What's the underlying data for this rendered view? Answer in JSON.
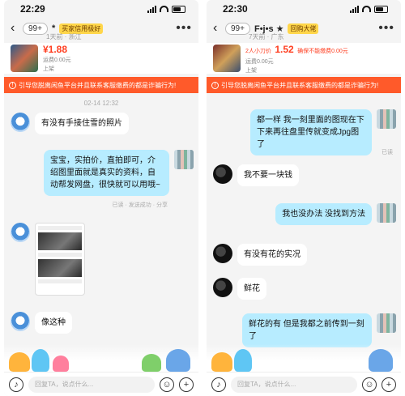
{
  "left": {
    "status": {
      "time": "22:29"
    },
    "nav": {
      "unread_badge": "99+",
      "name": "*",
      "tag": "买家信用极好",
      "sub": "1天前 · 浙江"
    },
    "product": {
      "price": "¥1.88",
      "shipping": "运费0.00元",
      "status": "上架"
    },
    "warning": "引导您脱离闲鱼平台并且联系客服缴费的都是诈骗行为!",
    "chat": {
      "date": "02-14 12:32",
      "messages": [
        {
          "side": "left",
          "text": "有没有手接住雪的照片"
        },
        {
          "side": "right",
          "text": "宝宝，实拍价，直拍即可，介绍图里面就是真实的资料，自动帮发网盘，很快就可以用哦~"
        },
        {
          "side": "left",
          "type": "image"
        },
        {
          "side": "left",
          "text": "像这种"
        }
      ],
      "read_meta": "已读 · 发送成功 · 分享"
    },
    "input_placeholder": "回复TA，说点什么..."
  },
  "right": {
    "status": {
      "time": "22:30"
    },
    "nav": {
      "unread_badge": "99+",
      "name": "F•j•s ★",
      "tag": "回购大佬",
      "sub": "7天前 · 广东"
    },
    "product": {
      "prefix": "2人小刀价",
      "price": "1.52",
      "promo": "确保不能缴费0.00元",
      "shipping": "运费0.00元",
      "status": "上架"
    },
    "warning": "引导您脱离闲鱼平台并且联系客服缴费的都是诈骗行为!",
    "chat": {
      "messages": [
        {
          "side": "right",
          "text": "都一样 我一刻里面的图现在下下来再往盘里传就变成Jpg图了"
        },
        {
          "side": "left",
          "text": "我不要一块钱"
        },
        {
          "side": "right",
          "text": "我也没办法 没找到方法"
        },
        {
          "side": "left",
          "text": "有没有花的实况"
        },
        {
          "side": "left",
          "text": "鲜花"
        },
        {
          "side": "right",
          "text": "鲜花的有 但是我都之前传到一刻了"
        }
      ],
      "read_meta": "已读"
    },
    "input_placeholder": "回复TA，说点什么..."
  },
  "colors": {
    "accent": "#ff5a2a",
    "bubble_right": "#b7ecff",
    "price": "#ff3d1f"
  },
  "icons": [
    "back-icon",
    "more-icon",
    "voice-icon",
    "emoji-icon",
    "plus-icon",
    "signal-icon",
    "wifi-icon",
    "battery-icon"
  ]
}
